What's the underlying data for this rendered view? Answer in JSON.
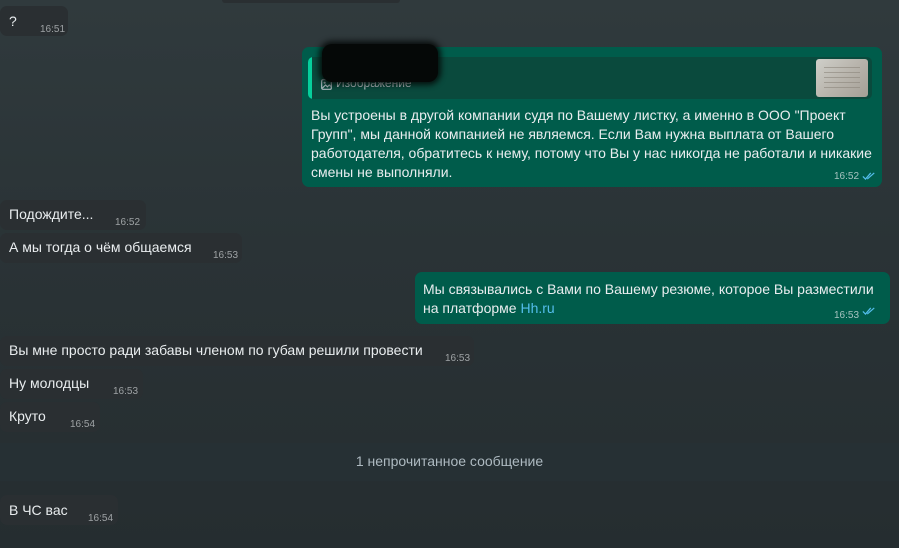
{
  "messages": [
    {
      "text": "?",
      "time": "16:51"
    },
    {
      "quote_label": "Изображение",
      "lines": [
        "Вы устроены в другой компании судя по Вашему листку, а именно в ООО \"Проект",
        "Групп\", мы данной компанией не являемся. Если Вам нужна выплата от Вашего",
        "работодателя, обратитесь к нему, потому что Вы у нас никогда не работали и никакие",
        "смены не выполняли."
      ],
      "time": "16:52"
    },
    {
      "text": "Подождите...",
      "time": "16:52"
    },
    {
      "text": "А мы тогда о чём общаемся",
      "time": "16:53"
    },
    {
      "lines": [
        "Мы связывались с Вами по Вашему резюме, которое Вы разместили",
        "на платформе "
      ],
      "link": "Hh.ru",
      "time": "16:53"
    },
    {
      "text": "Вы мне просто ради забавы членом по губам решили провести",
      "time": "16:53"
    },
    {
      "text": "Ну молодцы",
      "time": "16:53"
    },
    {
      "text": "Круто",
      "time": "16:54"
    },
    {
      "text": "В ЧС вас",
      "time": "16:54"
    }
  ],
  "unread_banner": "1 непрочитанное сообщение",
  "colors": {
    "incoming": "#2a2f32",
    "outgoing": "#005c4b",
    "link": "#53bdeb",
    "read_ticks": "#53bdeb"
  },
  "icons": {
    "quote": "image-icon",
    "status": "double-check-icon"
  }
}
